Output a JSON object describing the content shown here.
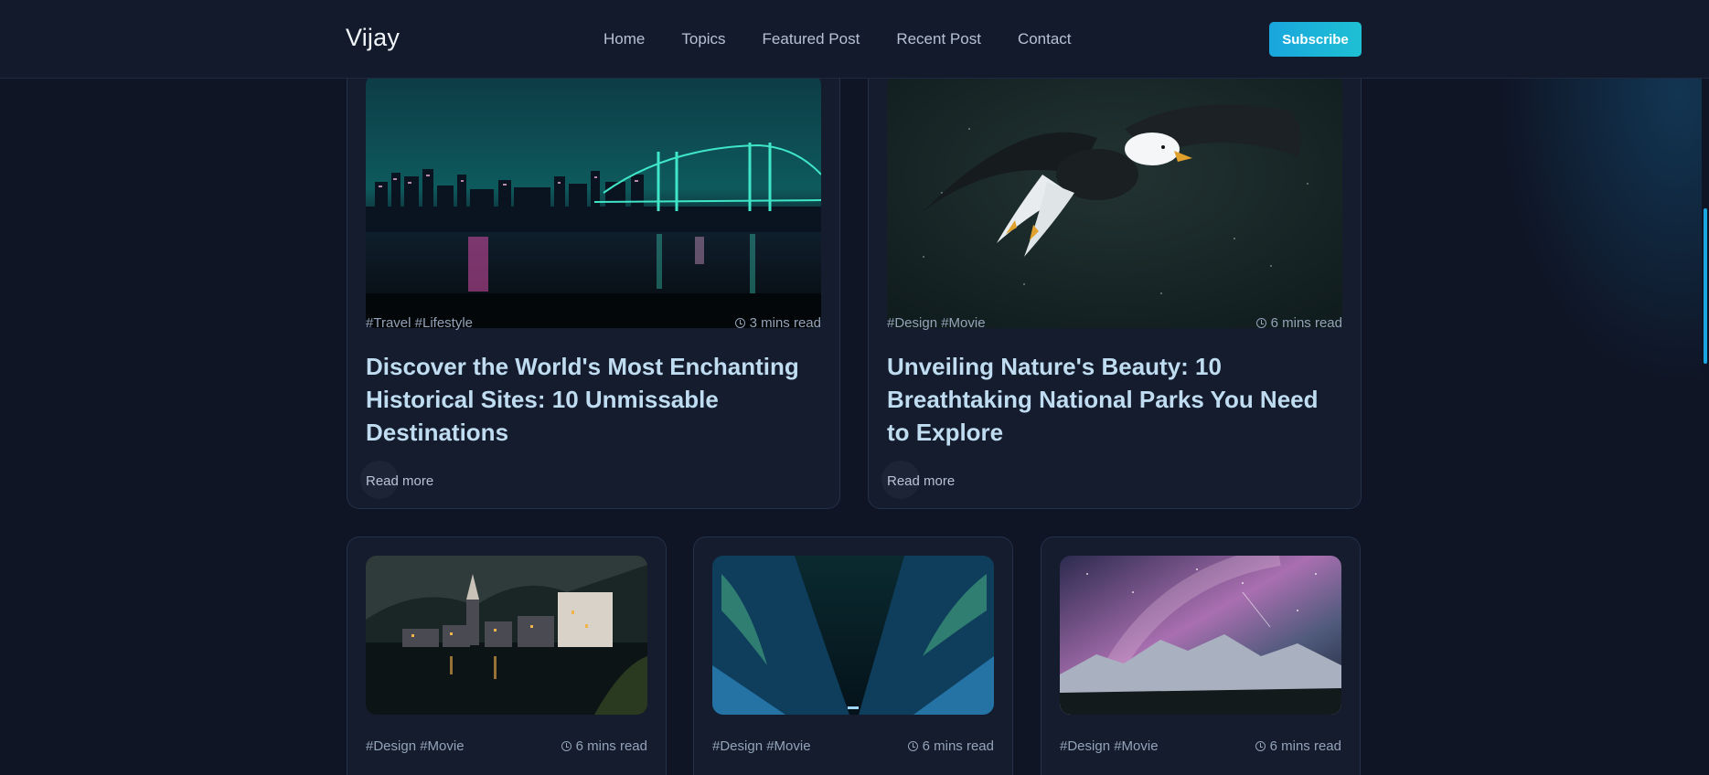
{
  "header": {
    "logo": "Vijay",
    "nav": [
      "Home",
      "Topics",
      "Featured Post",
      "Recent Post",
      "Contact"
    ],
    "subscribe_label": "Subscribe"
  },
  "featured": [
    {
      "image": "city-night-bridge",
      "tags": "#Travel #Lifestyle",
      "read_time": "3 mins read",
      "title": "Discover the World's Most Enchanting Historical Sites: 10 Unmissable Destinations",
      "read_more": "Read more"
    },
    {
      "image": "eagle-flying",
      "tags": "#Design #Movie",
      "read_time": "6 mins read",
      "title": "Unveiling Nature's Beauty: 10 Breathtaking National Parks You Need to Explore",
      "read_more": "Read more"
    }
  ],
  "recent": [
    {
      "image": "lakeside-village",
      "tags": "#Design #Movie",
      "read_time": "6 mins read"
    },
    {
      "image": "aurora-canyon",
      "tags": "#Design #Movie",
      "read_time": "6 mins read"
    },
    {
      "image": "milky-way-mountains",
      "tags": "#Design #Movie",
      "read_time": "6 mins read"
    }
  ],
  "colors": {
    "background": "#0f1525",
    "card": "#141c2e",
    "accent": "#1aa7e0",
    "title": "#bfdcf0"
  }
}
